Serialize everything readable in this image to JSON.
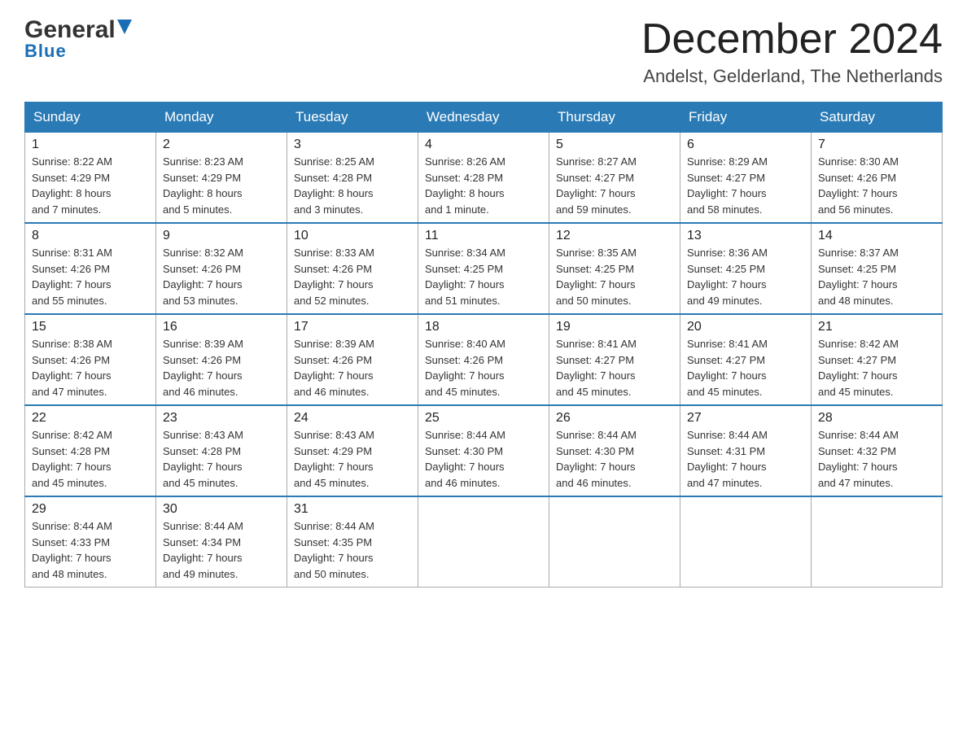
{
  "header": {
    "logo_general": "General",
    "logo_blue": "Blue",
    "month_title": "December 2024",
    "location": "Andelst, Gelderland, The Netherlands"
  },
  "weekdays": [
    "Sunday",
    "Monday",
    "Tuesday",
    "Wednesday",
    "Thursday",
    "Friday",
    "Saturday"
  ],
  "weeks": [
    [
      {
        "day": "1",
        "sunrise": "8:22 AM",
        "sunset": "4:29 PM",
        "daylight": "8 hours and 7 minutes."
      },
      {
        "day": "2",
        "sunrise": "8:23 AM",
        "sunset": "4:29 PM",
        "daylight": "8 hours and 5 minutes."
      },
      {
        "day": "3",
        "sunrise": "8:25 AM",
        "sunset": "4:28 PM",
        "daylight": "8 hours and 3 minutes."
      },
      {
        "day": "4",
        "sunrise": "8:26 AM",
        "sunset": "4:28 PM",
        "daylight": "8 hours and 1 minute."
      },
      {
        "day": "5",
        "sunrise": "8:27 AM",
        "sunset": "4:27 PM",
        "daylight": "7 hours and 59 minutes."
      },
      {
        "day": "6",
        "sunrise": "8:29 AM",
        "sunset": "4:27 PM",
        "daylight": "7 hours and 58 minutes."
      },
      {
        "day": "7",
        "sunrise": "8:30 AM",
        "sunset": "4:26 PM",
        "daylight": "7 hours and 56 minutes."
      }
    ],
    [
      {
        "day": "8",
        "sunrise": "8:31 AM",
        "sunset": "4:26 PM",
        "daylight": "7 hours and 55 minutes."
      },
      {
        "day": "9",
        "sunrise": "8:32 AM",
        "sunset": "4:26 PM",
        "daylight": "7 hours and 53 minutes."
      },
      {
        "day": "10",
        "sunrise": "8:33 AM",
        "sunset": "4:26 PM",
        "daylight": "7 hours and 52 minutes."
      },
      {
        "day": "11",
        "sunrise": "8:34 AM",
        "sunset": "4:25 PM",
        "daylight": "7 hours and 51 minutes."
      },
      {
        "day": "12",
        "sunrise": "8:35 AM",
        "sunset": "4:25 PM",
        "daylight": "7 hours and 50 minutes."
      },
      {
        "day": "13",
        "sunrise": "8:36 AM",
        "sunset": "4:25 PM",
        "daylight": "7 hours and 49 minutes."
      },
      {
        "day": "14",
        "sunrise": "8:37 AM",
        "sunset": "4:25 PM",
        "daylight": "7 hours and 48 minutes."
      }
    ],
    [
      {
        "day": "15",
        "sunrise": "8:38 AM",
        "sunset": "4:26 PM",
        "daylight": "7 hours and 47 minutes."
      },
      {
        "day": "16",
        "sunrise": "8:39 AM",
        "sunset": "4:26 PM",
        "daylight": "7 hours and 46 minutes."
      },
      {
        "day": "17",
        "sunrise": "8:39 AM",
        "sunset": "4:26 PM",
        "daylight": "7 hours and 46 minutes."
      },
      {
        "day": "18",
        "sunrise": "8:40 AM",
        "sunset": "4:26 PM",
        "daylight": "7 hours and 45 minutes."
      },
      {
        "day": "19",
        "sunrise": "8:41 AM",
        "sunset": "4:27 PM",
        "daylight": "7 hours and 45 minutes."
      },
      {
        "day": "20",
        "sunrise": "8:41 AM",
        "sunset": "4:27 PM",
        "daylight": "7 hours and 45 minutes."
      },
      {
        "day": "21",
        "sunrise": "8:42 AM",
        "sunset": "4:27 PM",
        "daylight": "7 hours and 45 minutes."
      }
    ],
    [
      {
        "day": "22",
        "sunrise": "8:42 AM",
        "sunset": "4:28 PM",
        "daylight": "7 hours and 45 minutes."
      },
      {
        "day": "23",
        "sunrise": "8:43 AM",
        "sunset": "4:28 PM",
        "daylight": "7 hours and 45 minutes."
      },
      {
        "day": "24",
        "sunrise": "8:43 AM",
        "sunset": "4:29 PM",
        "daylight": "7 hours and 45 minutes."
      },
      {
        "day": "25",
        "sunrise": "8:44 AM",
        "sunset": "4:30 PM",
        "daylight": "7 hours and 46 minutes."
      },
      {
        "day": "26",
        "sunrise": "8:44 AM",
        "sunset": "4:30 PM",
        "daylight": "7 hours and 46 minutes."
      },
      {
        "day": "27",
        "sunrise": "8:44 AM",
        "sunset": "4:31 PM",
        "daylight": "7 hours and 47 minutes."
      },
      {
        "day": "28",
        "sunrise": "8:44 AM",
        "sunset": "4:32 PM",
        "daylight": "7 hours and 47 minutes."
      }
    ],
    [
      {
        "day": "29",
        "sunrise": "8:44 AM",
        "sunset": "4:33 PM",
        "daylight": "7 hours and 48 minutes."
      },
      {
        "day": "30",
        "sunrise": "8:44 AM",
        "sunset": "4:34 PM",
        "daylight": "7 hours and 49 minutes."
      },
      {
        "day": "31",
        "sunrise": "8:44 AM",
        "sunset": "4:35 PM",
        "daylight": "7 hours and 50 minutes."
      },
      null,
      null,
      null,
      null
    ]
  ],
  "labels": {
    "sunrise": "Sunrise:",
    "sunset": "Sunset:",
    "daylight": "Daylight:"
  }
}
